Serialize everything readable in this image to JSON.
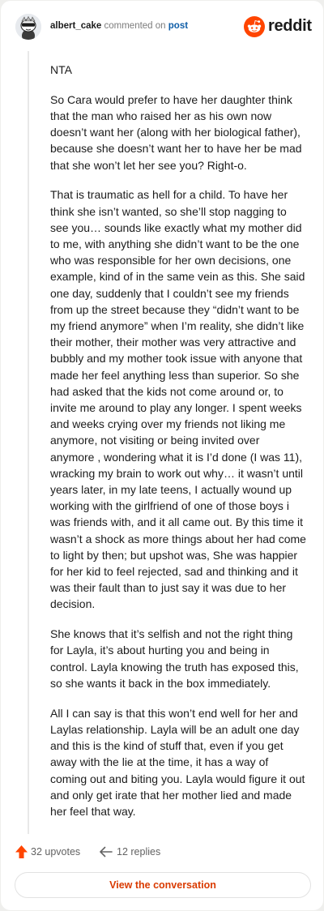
{
  "comment": {
    "username": "albert_cake",
    "action_text": " commented on ",
    "post_link": "post",
    "paragraphs": [
      "NTA",
      "So Cara would prefer to have her daughter think that the man who raised her as his own now doesn’t want her (along with her biological father), because she doesn’t want her to have her be mad that she won’t let her see you? Right-o.",
      "That is traumatic as hell for a child. To have her think she isn’t wanted, so she’ll stop nagging to see you… sounds like exactly what my mother did to me, with anything she didn’t want to be the one who was responsible for her own decisions, one example, kind of in the same vein as this. She said one day, suddenly that I couldn’t see my friends from up the street because they “didn’t want to be my friend anymore” when I’m reality, she didn’t like their mother, their mother was very attractive and bubbly and my mother took issue with anyone that made her feel anything less than superior. So she had asked that the kids not come around or, to invite me around to play any longer. I spent weeks and weeks crying over my friends not liking me anymore, not visiting or being invited over anymore , wondering what it is I’d done (I was 11), wracking my brain to work out why… it wasn’t until years later, in my late teens, I actually wound up working with the girlfriend of one of those boys i was friends with, and it all came out. By this time it wasn’t a shock as more things about her had come to light by then; but upshot was, She was happier for her kid to feel rejected, sad and thinking and it was their fault than to just say it was due to her decision.",
      "She knows that it’s selfish and not the right thing for Layla, it’s about hurting you and being in control. Layla knowing the truth has exposed this, so she wants it back in the box immediately.",
      "All I can say is that this won’t end well for her and Laylas relationship. Layla will be an adult one day and this is the kind of stuff that, even if you get away with the lie at the time, it has a way of coming out and biting you. Layla would figure it out and only get irate that her mother lied and made her feel that way."
    ],
    "upvotes": "32 upvotes",
    "replies": "12 replies"
  },
  "brand": {
    "name": "reddit",
    "icon": "reddit-logo-icon",
    "color": "#ff4500"
  },
  "view_button": "View the conversation",
  "colors": {
    "accent": "#d93a00",
    "upvote": "#ff4500",
    "link": "#0f5ea8"
  }
}
